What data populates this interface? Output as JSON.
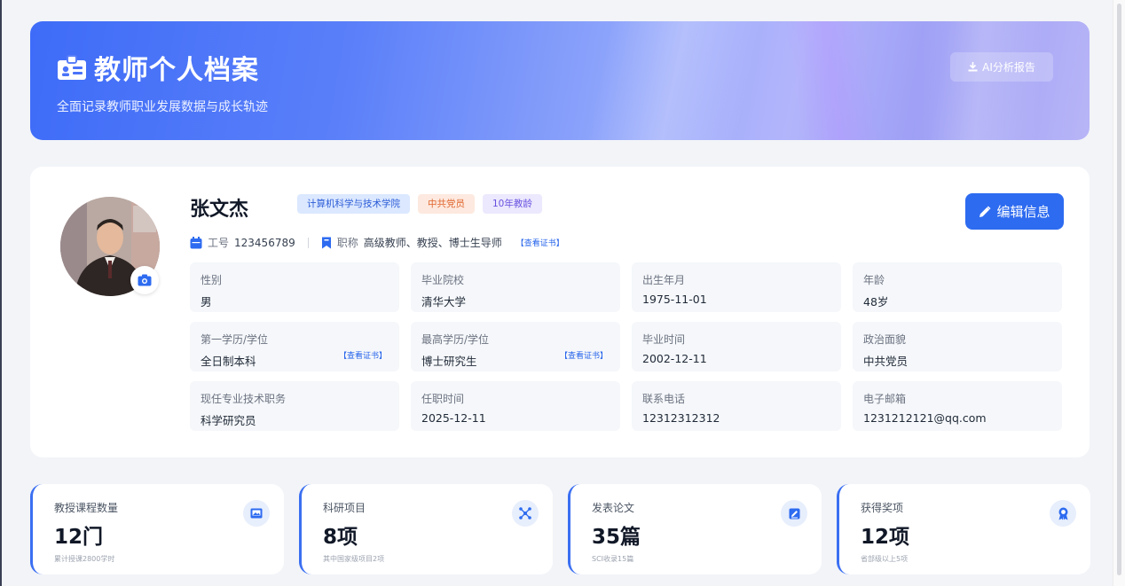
{
  "header": {
    "title": "教师个人档案",
    "subtitle": "全面记录教师职业发展数据与成长轨迹",
    "ai_button": "AI分析报告"
  },
  "profile": {
    "name": "张文杰",
    "tags": [
      "计算机科学与技术学院",
      "中共党员",
      "10年教龄"
    ],
    "edit_button": "编辑信息",
    "employee_id_label": "工号",
    "employee_id": "123456789",
    "title_label": "职称",
    "title_value": "高级教师、教授、博士生导师",
    "view_cert": "【查看证书】",
    "fields": [
      {
        "label": "性别",
        "value": "男"
      },
      {
        "label": "毕业院校",
        "value": "清华大学"
      },
      {
        "label": "出生年月",
        "value": "1975-11-01"
      },
      {
        "label": "年龄",
        "value": "48岁"
      },
      {
        "label": "第一学历/学位",
        "value": "全日制本科",
        "cert": "【查看证书】"
      },
      {
        "label": "最高学历/学位",
        "value": "博士研究生",
        "cert": "【查看证书】"
      },
      {
        "label": "毕业时间",
        "value": "2002-12-11"
      },
      {
        "label": "政治面貌",
        "value": "中共党员"
      },
      {
        "label": "现任专业技术职务",
        "value": "科学研究员"
      },
      {
        "label": "任职时间",
        "value": "2025-12-11"
      },
      {
        "label": "联系电话",
        "value": "12312312312"
      },
      {
        "label": "电子邮箱",
        "value": "1231212121@qq.com"
      }
    ]
  },
  "stats": [
    {
      "title": "教授课程数量",
      "value": "12门",
      "desc": "累计授课2800学时",
      "icon": "image-icon"
    },
    {
      "title": "科研项目",
      "value": "8项",
      "desc": "其中国家级项目2项",
      "icon": "molecule-icon"
    },
    {
      "title": "发表论文",
      "value": "35篇",
      "desc": "SCI收录15篇",
      "icon": "edit-doc-icon"
    },
    {
      "title": "获得奖项",
      "value": "12项",
      "desc": "省部级以上5项",
      "icon": "award-icon"
    }
  ],
  "colors": {
    "primary": "#2d6bf0",
    "accent_border": "#3b6ff2"
  }
}
